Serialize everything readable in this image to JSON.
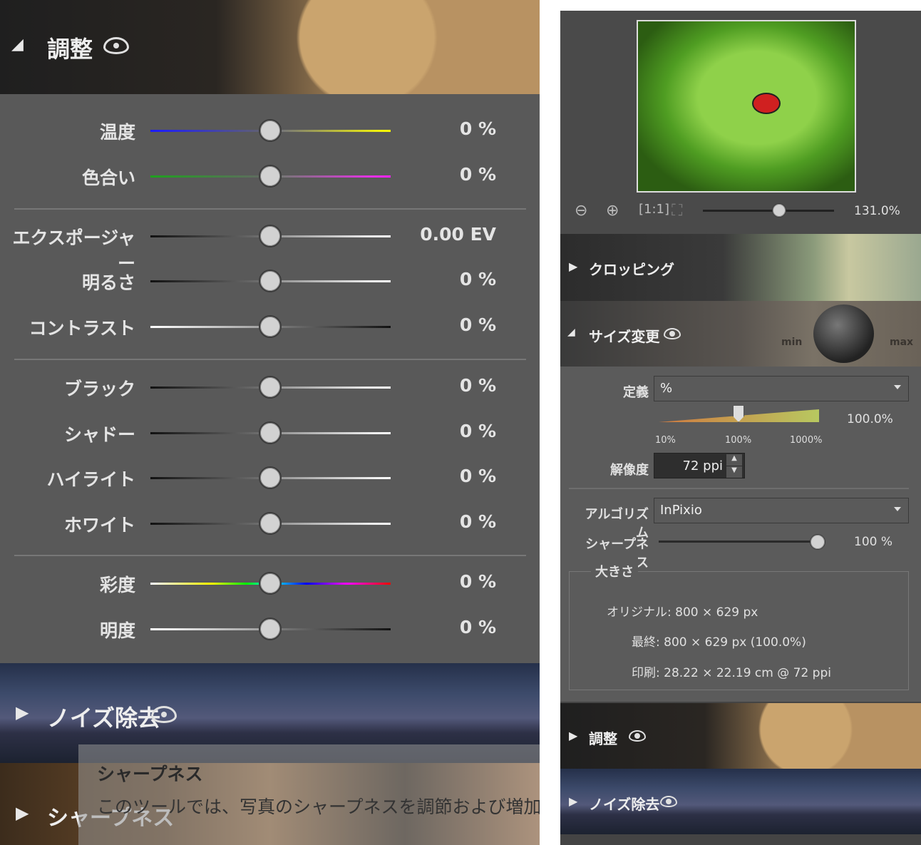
{
  "left": {
    "adjust_header": {
      "title": "調整"
    },
    "rows": [
      {
        "label": "温度",
        "value": "0 %"
      },
      {
        "label": "色合い",
        "value": "0 %"
      },
      {
        "label": "エクスポージャー",
        "value": "0.00 EV"
      },
      {
        "label": "明るさ",
        "value": "0 %"
      },
      {
        "label": "コントラスト",
        "value": "0 %"
      },
      {
        "label": "ブラック",
        "value": "0 %"
      },
      {
        "label": "シャドー",
        "value": "0 %"
      },
      {
        "label": "ハイライト",
        "value": "0 %"
      },
      {
        "label": "ホワイト",
        "value": "0 %"
      },
      {
        "label": "彩度",
        "value": "0 %"
      },
      {
        "label": "明度",
        "value": "0 %"
      }
    ],
    "noise_header": {
      "title": "ノイズ除去"
    },
    "sharpness_header": {
      "title": "シャープネス"
    },
    "tooltip": {
      "title": "シャープネス",
      "text": "このツールでは、写真のシャープネスを調節および増加させま"
    }
  },
  "right": {
    "zoom": {
      "value": "131.0%",
      "level": 0.58
    },
    "crop_header": {
      "title": "クロッピング"
    },
    "resize_header": {
      "title": "サイズ変更",
      "min": "min",
      "max": "max"
    },
    "definition": {
      "label": "定義",
      "value": "%"
    },
    "scale": {
      "value": "100.0%",
      "ticks": [
        "10%",
        "100%",
        "1000%"
      ]
    },
    "resolution": {
      "label": "解像度",
      "value": "72 ppi"
    },
    "algorithm": {
      "label": "アルゴリズム",
      "value": "InPixio"
    },
    "sharpness": {
      "label": "シャープネス",
      "value": "100 %"
    },
    "size": {
      "legend": "大きさ",
      "original": "オリジナル: 800 × 629 px",
      "final": "最終: 800 × 629 px (100.0%)",
      "print": "印刷: 28.22 × 22.19 cm @ 72 ppi"
    },
    "adjust_header": {
      "title": "調整"
    },
    "noise_header": {
      "title": "ノイズ除去"
    }
  }
}
